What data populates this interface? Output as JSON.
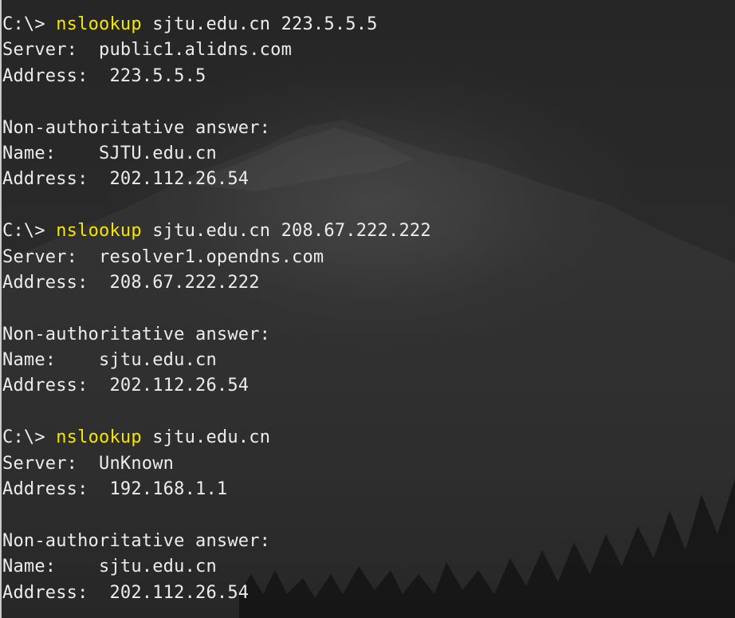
{
  "session": [
    {
      "prompt": "C:\\>",
      "command": "nslookup",
      "args": "sjtu.edu.cn 223.5.5.5",
      "lines": [
        "Server:  public1.alidns.com",
        "Address:  223.5.5.5",
        "",
        "Non-authoritative answer:",
        "Name:    SJTU.edu.cn",
        "Address:  202.112.26.54",
        ""
      ]
    },
    {
      "prompt": "C:\\>",
      "command": "nslookup",
      "args": "sjtu.edu.cn 208.67.222.222",
      "lines": [
        "Server:  resolver1.opendns.com",
        "Address:  208.67.222.222",
        "",
        "Non-authoritative answer:",
        "Name:    sjtu.edu.cn",
        "Address:  202.112.26.54",
        ""
      ]
    },
    {
      "prompt": "C:\\>",
      "command": "nslookup",
      "args": "sjtu.edu.cn",
      "lines": [
        "Server:  UnKnown",
        "Address:  192.168.1.1",
        "",
        "Non-authoritative answer:",
        "Name:    sjtu.edu.cn",
        "Address:  202.112.26.54"
      ]
    }
  ],
  "colors": {
    "command_highlight": "#f5e600",
    "text": "#ececec",
    "background": "#242424"
  }
}
